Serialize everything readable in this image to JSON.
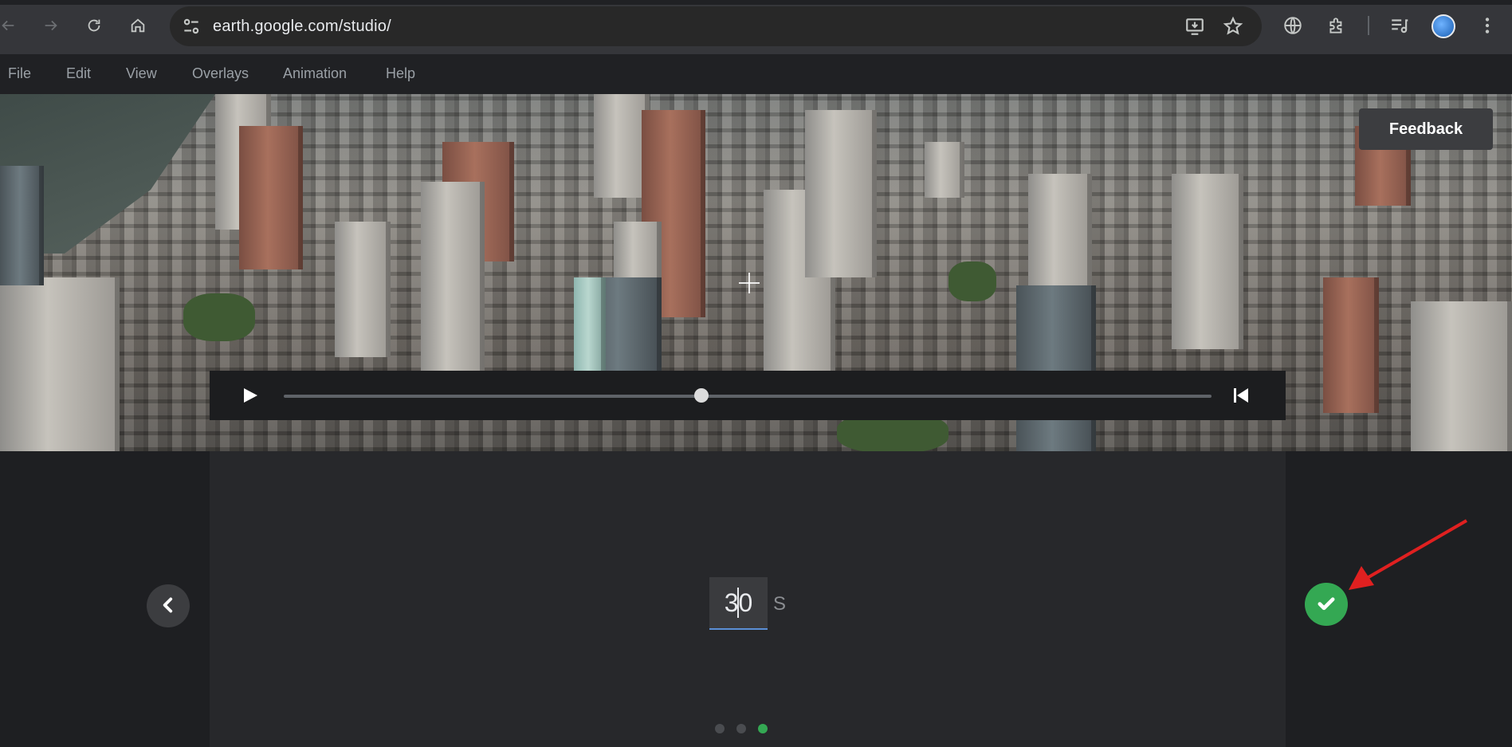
{
  "browser": {
    "url": "earth.google.com/studio/"
  },
  "menu": {
    "items": [
      "File",
      "Edit",
      "View",
      "Overlays",
      "Animation",
      "Help"
    ]
  },
  "viewport": {
    "feedback_label": "Feedback"
  },
  "timeline": {
    "progress": 0.45
  },
  "duration": {
    "value": "30",
    "unit": "S"
  },
  "steps": {
    "count": 3,
    "active_index": 2
  },
  "colors": {
    "accent_green": "#34a853",
    "input_underline": "#5b8fd6",
    "annotation_red": "#e02020"
  },
  "icons": {
    "back": "back-arrow-icon",
    "forward": "forward-arrow-icon",
    "reload": "reload-icon",
    "home": "home-icon",
    "site_info": "site-info-icon",
    "install": "install-app-icon",
    "bookmark": "star-icon",
    "translate": "globe-icon",
    "extensions": "puzzle-icon",
    "media": "media-control-icon",
    "menu": "kebab-menu-icon",
    "play": "play-icon",
    "skip_to_start": "skip-start-icon",
    "previous": "chevron-left-icon",
    "confirm": "checkmark-icon"
  }
}
